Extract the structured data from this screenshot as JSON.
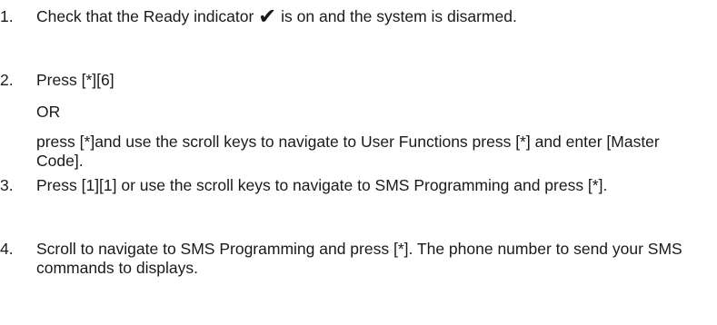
{
  "steps": [
    {
      "number": "1.",
      "before_icon": "Check that the Ready indicator ",
      "icon": "checkmark-icon",
      "icon_glyph": "✔",
      "after_icon": " is on and the system is disarmed."
    },
    {
      "number": "2.",
      "text": "Press [*][6]",
      "or_text": "OR",
      "alt_text": "press [*]and use the scroll keys to navigate to User Functions press [*] and enter [Master Code]."
    },
    {
      "number": "3.",
      "text": "Press [1][1] or use the scroll keys to navigate to SMS Programming and press [*]."
    },
    {
      "number": "4.",
      "text": "Scroll to navigate to SMS Programming and press [*]. The phone number to send your SMS commands to displays."
    }
  ]
}
